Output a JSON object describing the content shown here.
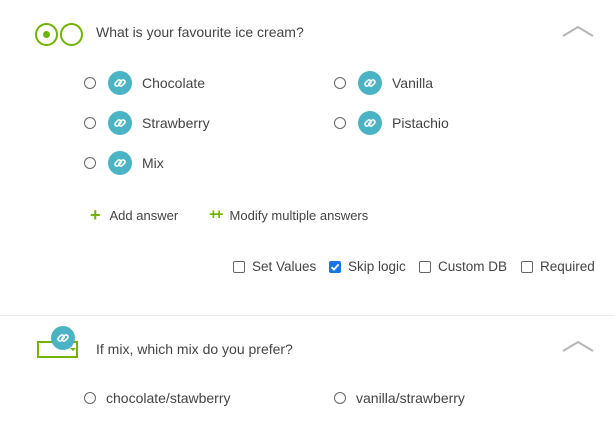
{
  "question1": {
    "type_icon": "radio-choice-icon",
    "title": "What is your favourite ice cream?",
    "collapse_icon": "chevron-up-icon",
    "link_icon": "link-icon",
    "answers": [
      {
        "label": "Chocolate"
      },
      {
        "label": "Vanilla"
      },
      {
        "label": "Strawberry"
      },
      {
        "label": "Pistachio"
      },
      {
        "label": "Mix"
      }
    ],
    "actions": {
      "add_answer": "Add answer",
      "add_answer_icon": "plus-icon",
      "modify_multiple": "Modify multiple answers",
      "modify_multiple_icon": "plus-multiple-icon"
    },
    "options": [
      {
        "label": "Set Values",
        "checked": false
      },
      {
        "label": "Skip logic",
        "checked": true
      },
      {
        "label": "Custom DB",
        "checked": false
      },
      {
        "label": "Required",
        "checked": false
      }
    ]
  },
  "question2": {
    "type_icon": "dropdown-choice-icon",
    "linked_icon": "link-icon",
    "title": "If mix, which mix do you prefer?",
    "collapse_icon": "chevron-up-icon",
    "answers": [
      {
        "label": "chocolate/stawberry"
      },
      {
        "label": "vanilla/strawberry"
      }
    ]
  },
  "colors": {
    "accent_green": "#71b300",
    "link_teal": "#4ab3c4",
    "checkbox_blue": "#1a73e8"
  }
}
